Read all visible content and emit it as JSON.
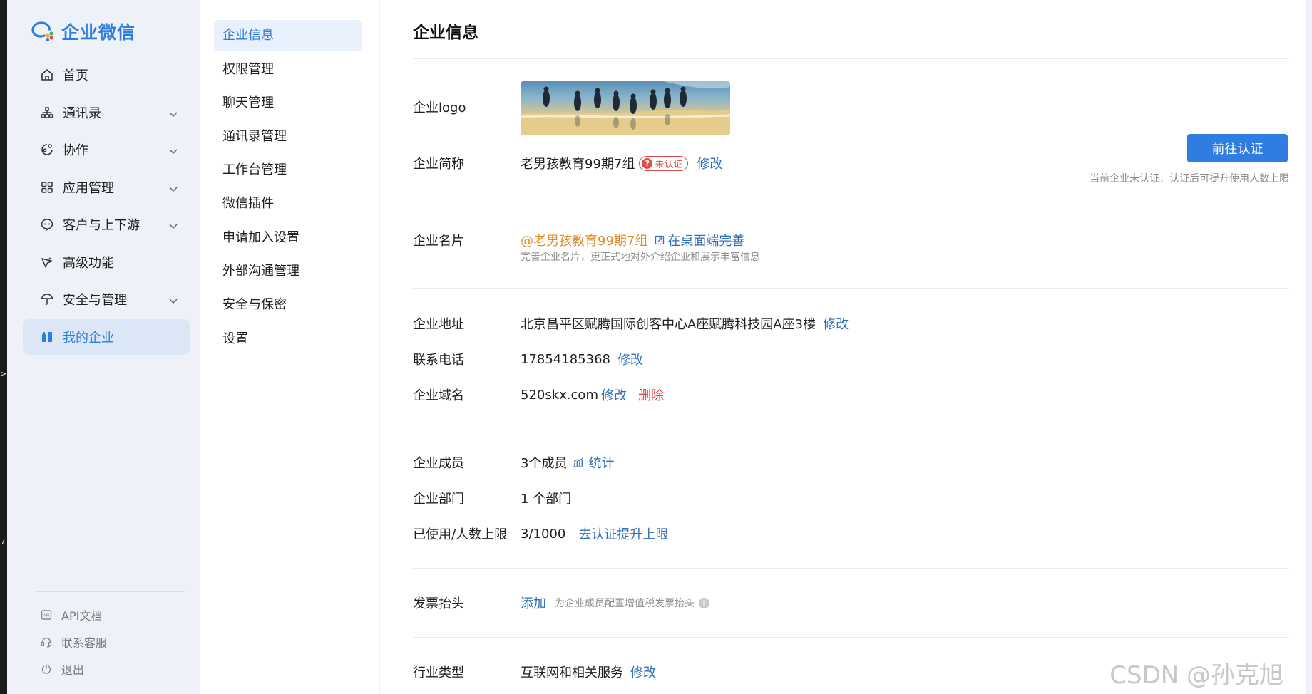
{
  "app": {
    "name": "企业微信"
  },
  "edge_marks": [
    ">",
    "7"
  ],
  "sidebar": {
    "items": [
      {
        "label": "首页",
        "icon": "home-icon",
        "has_chevron": false,
        "active": false
      },
      {
        "label": "通讯录",
        "icon": "org-chart-icon",
        "has_chevron": true,
        "active": false
      },
      {
        "label": "协作",
        "icon": "collab-icon",
        "has_chevron": true,
        "active": false
      },
      {
        "label": "应用管理",
        "icon": "apps-grid-icon",
        "has_chevron": true,
        "active": false
      },
      {
        "label": "客户与上下游",
        "icon": "chat-bubble-icon",
        "has_chevron": true,
        "active": false
      },
      {
        "label": "高级功能",
        "icon": "sparkle-icon",
        "has_chevron": false,
        "active": false
      },
      {
        "label": "安全与管理",
        "icon": "umbrella-icon",
        "has_chevron": true,
        "active": false
      },
      {
        "label": "我的企业",
        "icon": "building-icon",
        "has_chevron": false,
        "active": true
      }
    ],
    "footer": [
      {
        "label": "API文档",
        "icon": "api-doc-icon"
      },
      {
        "label": "联系客服",
        "icon": "headset-icon"
      },
      {
        "label": "退出",
        "icon": "power-icon"
      }
    ]
  },
  "submenu": {
    "items": [
      {
        "label": "企业信息",
        "active": true
      },
      {
        "label": "权限管理",
        "active": false
      },
      {
        "label": "聊天管理",
        "active": false
      },
      {
        "label": "通讯录管理",
        "active": false
      },
      {
        "label": "工作台管理",
        "active": false
      },
      {
        "label": "微信插件",
        "active": false
      },
      {
        "label": "申请加入设置",
        "active": false
      },
      {
        "label": "外部沟通管理",
        "active": false
      },
      {
        "label": "安全与保密",
        "active": false
      },
      {
        "label": "设置",
        "active": false
      }
    ]
  },
  "main": {
    "title": "企业信息",
    "logo": {
      "label": "企业logo"
    },
    "short_name": {
      "label": "企业简称",
      "value": "老男孩教育99期7组",
      "badge": "未认证",
      "badge_icon": "?",
      "edit": "修改"
    },
    "verify": {
      "button": "前往认证",
      "hint": "当前企业未认证，认证后可提升使用人数上限"
    },
    "card": {
      "label": "企业名片",
      "value": "@老男孩教育99期7组",
      "link": "在桌面端完善",
      "hint": "完善企业名片，更正式地对外介绍企业和展示丰富信息"
    },
    "address": {
      "label": "企业地址",
      "value": "北京昌平区赋腾国际创客中心A座赋腾科技园A座3楼",
      "edit": "修改"
    },
    "phone": {
      "label": "联系电话",
      "value": "17854185368",
      "edit": "修改"
    },
    "domain": {
      "label": "企业域名",
      "value": "520skx.com",
      "edit": "修改",
      "delete": "删除"
    },
    "members": {
      "label": "企业成员",
      "value": "3个成员",
      "stats": "统计"
    },
    "departments": {
      "label": "企业部门",
      "value": "1 个部门"
    },
    "limit": {
      "label": "已使用/人数上限",
      "value": "3/1000",
      "link": "去认证提升上限"
    },
    "invoice": {
      "label": "发票抬头",
      "add": "添加",
      "hint": "为企业成员配置增值税发票抬头",
      "info_icon": "i"
    },
    "industry": {
      "label": "行业类型",
      "value": "互联网和相关服务",
      "edit": "修改"
    }
  },
  "watermark": "CSDN @孙克旭",
  "colors": {
    "accent": "#2f7de1",
    "link": "#2f6fb8",
    "danger": "#e04b4b",
    "orange": "#e08c2a",
    "sidebar_bg": "#eef2f8"
  }
}
